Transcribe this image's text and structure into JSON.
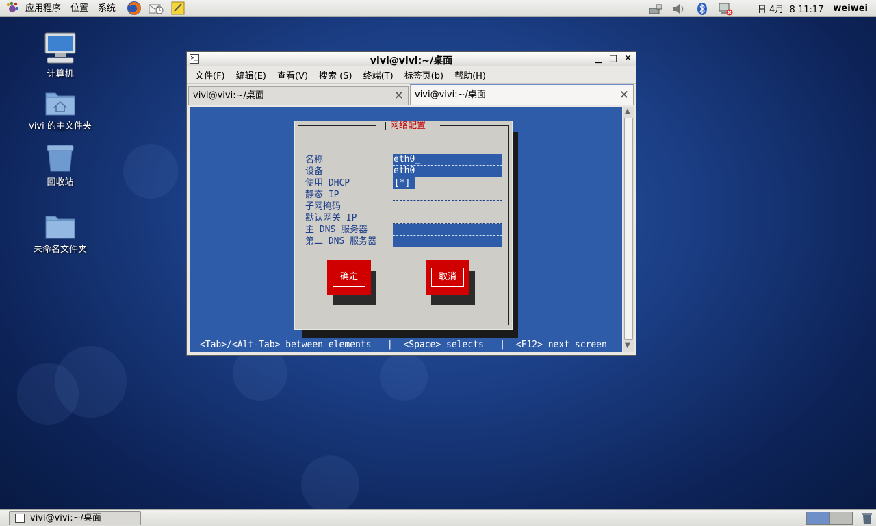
{
  "top_panel": {
    "menus": [
      "应用程序",
      "位置",
      "系统"
    ],
    "clock": "日 4月  8 11:17",
    "user": "weiwei"
  },
  "desktop": {
    "icons": [
      {
        "label": "计算机"
      },
      {
        "label": "vivi 的主文件夹"
      },
      {
        "label": "回收站"
      },
      {
        "label": "未命名文件夹"
      }
    ]
  },
  "window": {
    "title": "vivi@vivi:~/桌面",
    "menus": [
      "文件(F)",
      "编辑(E)",
      "查看(V)",
      "搜索 (S)",
      "终端(T)",
      "标签页(b)",
      "帮助(H)"
    ],
    "tabs": [
      {
        "label": "vivi@vivi:~/桌面"
      },
      {
        "label": "vivi@vivi:~/桌面"
      }
    ]
  },
  "dialog": {
    "title": "网络配置",
    "fields": [
      {
        "label": "名称",
        "value": "eth0_"
      },
      {
        "label": "设备",
        "value": "eth0"
      },
      {
        "label": "使用 DHCP",
        "value": "[*]"
      },
      {
        "label": "静态 IP",
        "value": ""
      },
      {
        "label": "子网掩码",
        "value": ""
      },
      {
        "label": "默认网关 IP",
        "value": ""
      },
      {
        "label": "主 DNS 服务器",
        "value": ""
      },
      {
        "label": "第二 DNS 服务器",
        "value": ""
      }
    ],
    "ok_label": "确定",
    "cancel_label": "取消"
  },
  "hint_bar": "<Tab>/<Alt-Tab> between elements   |  <Space> selects   |  <F12> next screen",
  "taskbar": {
    "task_label": "vivi@vivi:~/桌面"
  },
  "colors": {
    "terminal_bg": "#2f5ca8",
    "dialog_bg": "#cfcdc8",
    "button_red": "#d00000",
    "label_blue": "#1d3e8a",
    "title_red": "#c40000"
  }
}
